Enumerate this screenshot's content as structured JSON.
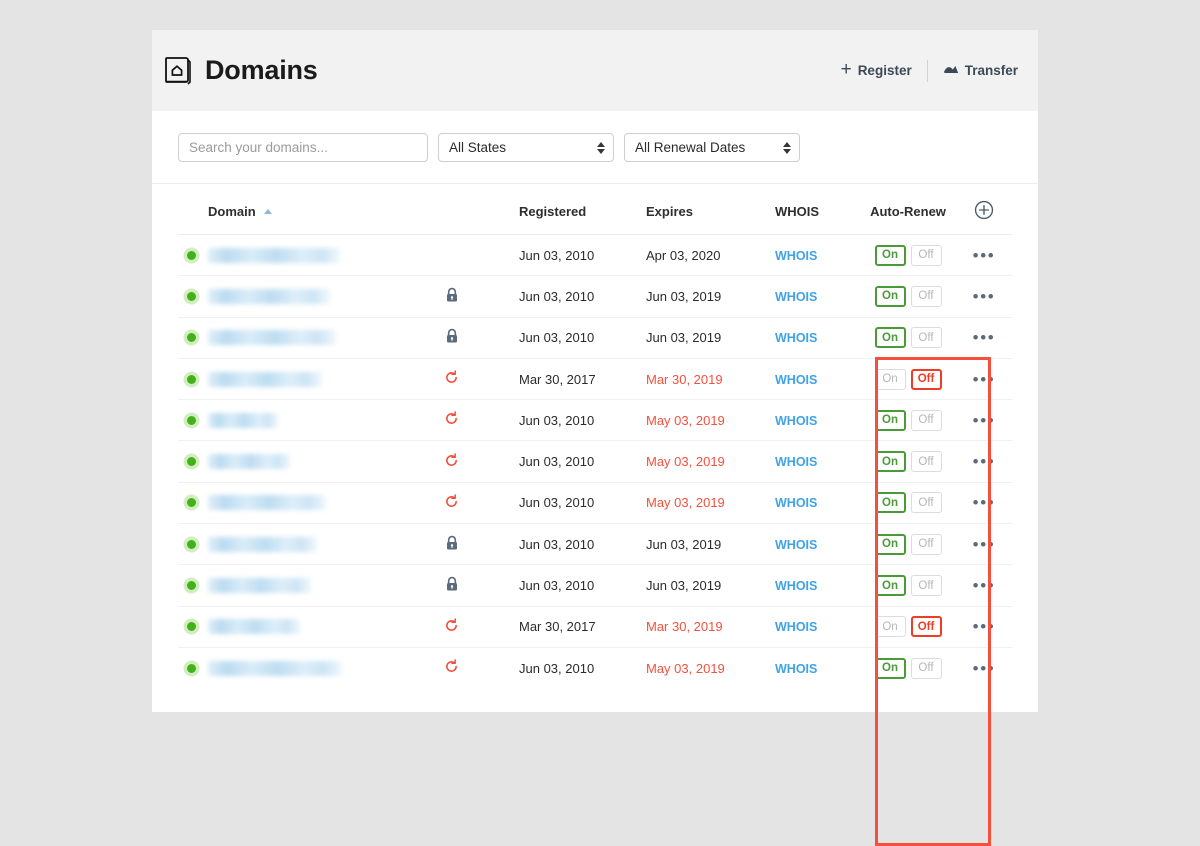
{
  "header": {
    "title": "Domains",
    "icon": "domains-book-icon",
    "actions": [
      {
        "label": "Register",
        "icon": "plus-icon"
      },
      {
        "label": "Transfer",
        "icon": "transfer-icon"
      }
    ]
  },
  "filters": {
    "search_placeholder": "Search your domains...",
    "search_value": "",
    "states_select": "All States",
    "renewal_select": "All Renewal Dates"
  },
  "table": {
    "columns": {
      "domain": "Domain",
      "registered": "Registered",
      "expires": "Expires",
      "whois": "WHOIS",
      "auto_renew": "Auto-Renew"
    },
    "sort": {
      "column": "Domain",
      "direction": "ascending"
    },
    "add_column_icon": "circle-plus-icon",
    "toggle_labels": {
      "on": "On",
      "off": "Off"
    },
    "whois_label": "WHOIS",
    "row_menu_label": "•••",
    "rows": [
      {
        "status": "active",
        "name_redacted": true,
        "name_width": 132,
        "flag_icon": "none",
        "registered": "Jun 03, 2010",
        "expires": "Apr 03, 2020",
        "expires_soon": false,
        "auto_renew": "on"
      },
      {
        "status": "active",
        "name_redacted": true,
        "name_width": 122,
        "flag_icon": "lock",
        "registered": "Jun 03, 2010",
        "expires": "Jun 03, 2019",
        "expires_soon": false,
        "auto_renew": "on"
      },
      {
        "status": "active",
        "name_redacted": true,
        "name_width": 128,
        "flag_icon": "lock",
        "registered": "Jun 03, 2010",
        "expires": "Jun 03, 2019",
        "expires_soon": false,
        "auto_renew": "on"
      },
      {
        "status": "active",
        "name_redacted": true,
        "name_width": 114,
        "flag_icon": "renew",
        "registered": "Mar 30, 2017",
        "expires": "Mar 30, 2019",
        "expires_soon": true,
        "auto_renew": "off"
      },
      {
        "status": "active",
        "name_redacted": true,
        "name_width": 70,
        "flag_icon": "renew",
        "registered": "Jun 03, 2010",
        "expires": "May 03, 2019",
        "expires_soon": true,
        "auto_renew": "on"
      },
      {
        "status": "active",
        "name_redacted": true,
        "name_width": 82,
        "flag_icon": "renew",
        "registered": "Jun 03, 2010",
        "expires": "May 03, 2019",
        "expires_soon": true,
        "auto_renew": "on"
      },
      {
        "status": "active",
        "name_redacted": true,
        "name_width": 118,
        "flag_icon": "renew",
        "registered": "Jun 03, 2010",
        "expires": "May 03, 2019",
        "expires_soon": true,
        "auto_renew": "on"
      },
      {
        "status": "active",
        "name_redacted": true,
        "name_width": 109,
        "flag_icon": "lock",
        "registered": "Jun 03, 2010",
        "expires": "Jun 03, 2019",
        "expires_soon": false,
        "auto_renew": "on"
      },
      {
        "status": "active",
        "name_redacted": true,
        "name_width": 103,
        "flag_icon": "lock",
        "registered": "Jun 03, 2010",
        "expires": "Jun 03, 2019",
        "expires_soon": false,
        "auto_renew": "on"
      },
      {
        "status": "active",
        "name_redacted": true,
        "name_width": 92,
        "flag_icon": "renew",
        "registered": "Mar 30, 2017",
        "expires": "Mar 30, 2019",
        "expires_soon": true,
        "auto_renew": "off"
      },
      {
        "status": "active",
        "name_redacted": true,
        "name_width": 134,
        "flag_icon": "renew",
        "registered": "Jun 03, 2010",
        "expires": "May 03, 2019",
        "expires_soon": true,
        "auto_renew": "on"
      }
    ]
  },
  "annotation": {
    "shape": "rectangle",
    "target": "Auto-Renew",
    "color": "#f4503c"
  },
  "colors": {
    "page_background": "#e4e4e4",
    "header_band": "#f2f2f2",
    "link_blue": "#3fa3e6",
    "expire_red": "#f4503c",
    "toggle_on_green": "#4a9a38",
    "toggle_off_red": "#ef3c26",
    "status_dot_green": "#45b11a",
    "lock_gray": "#5a6b7d"
  }
}
